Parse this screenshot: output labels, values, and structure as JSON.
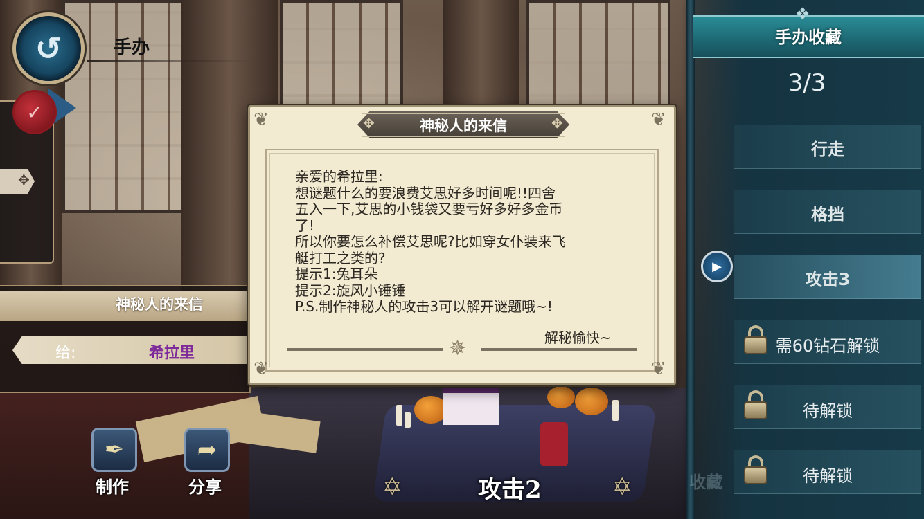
{
  "header": {
    "back_icon": "return-arrow-icon",
    "title": "手办"
  },
  "letter_panel": {
    "title": "神秘人的来信",
    "to_label": "给:",
    "to_name": "希拉里"
  },
  "bottom_buttons": [
    {
      "label": "制作",
      "icon": "craft-icon"
    },
    {
      "label": "分享",
      "icon": "share-icon"
    }
  ],
  "character_name": "攻击2",
  "sidebar": {
    "title": "手办收藏",
    "count": "3/3",
    "items": [
      {
        "label": "行走",
        "locked": false
      },
      {
        "label": "格挡",
        "locked": false
      },
      {
        "label": "攻击3",
        "locked": false,
        "selected": true
      },
      {
        "label": "需60钻石解锁",
        "locked": true
      },
      {
        "label": "待解锁",
        "locked": true
      },
      {
        "label": "待解锁",
        "locked": true
      }
    ],
    "watermark": "收藏"
  },
  "modal": {
    "title": "神秘人的来信",
    "lines": [
      "亲爱的希拉里:",
      "想谜题什么的要浪费艾思好多时间呢!!四舍",
      "五入一下,艾思的小钱袋又要亏好多好多金币",
      "了!",
      "所以你要怎么补偿艾思呢?比如穿女仆装来飞",
      "艇打工之类的?",
      "提示1:兔耳朵",
      "提示2:旋风小锤锤",
      "P.S.制作神秘人的攻击3可以解开谜题哦~!"
    ],
    "signoff": "解秘愉快~"
  },
  "colors": {
    "sidebar_bg": "#173a48",
    "sidebar_header": "#1e6b76",
    "modal_bg": "#f2ebd2",
    "recipient_purple": "#7e2a9a",
    "seal_red": "#c3303a"
  }
}
